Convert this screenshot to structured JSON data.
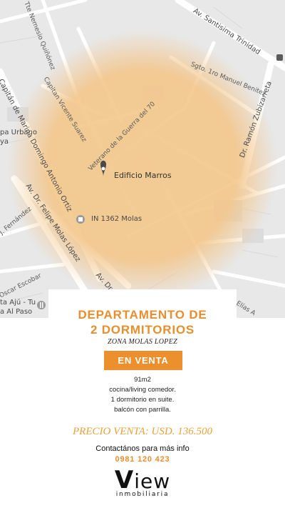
{
  "map": {
    "streets": [
      {
        "label": "Av. Santisima Trinidad"
      },
      {
        "label": "Tte Nemesio Quiñónez"
      },
      {
        "label": "Sgto. 1ro Manuel Benitez"
      },
      {
        "label": "Dr. Ramón Zubizarreta"
      },
      {
        "label": "Capitan Vicente Suarez"
      },
      {
        "label": "Veterano de la Guerra del 70"
      },
      {
        "label": "Capitán de Marina Domingo Antonio Ortiz"
      },
      {
        "label": "Av. Dr. Felipe Molas López"
      },
      {
        "label": "J. Fernández"
      },
      {
        "label": "Oscar Escobar"
      },
      {
        "label": "Elías A"
      },
      {
        "label": "Av. Dr."
      }
    ],
    "pois": {
      "building": "Edificio Marros",
      "address": "IN 1362 Molas",
      "left_top": "pa Urbano",
      "left_top2": "ya",
      "left_bottom": "ta Ajú - Tu",
      "left_bottom2": "a Al Paso"
    },
    "area_color": "#f2c98e"
  },
  "listing": {
    "title_line1": "DEPARTAMENTO DE",
    "title_line2": "2 DORMITORIOS",
    "zone": "ZONA MOLAS LOPEZ",
    "status_button": "EN VENTA",
    "features": [
      "91m2",
      "cocina/living comedor.",
      "1 dormitorio en suite.",
      "balcón con parrilla."
    ],
    "price": "PRECIO VENTA: USD. 136.500",
    "contact_text": "Contactános para más info",
    "phone": "0981 120 423"
  },
  "brand": {
    "logo_v": "V",
    "logo_rest": "iew",
    "tagline": "inmobiliaria",
    "accent": "#ec8f2d"
  }
}
